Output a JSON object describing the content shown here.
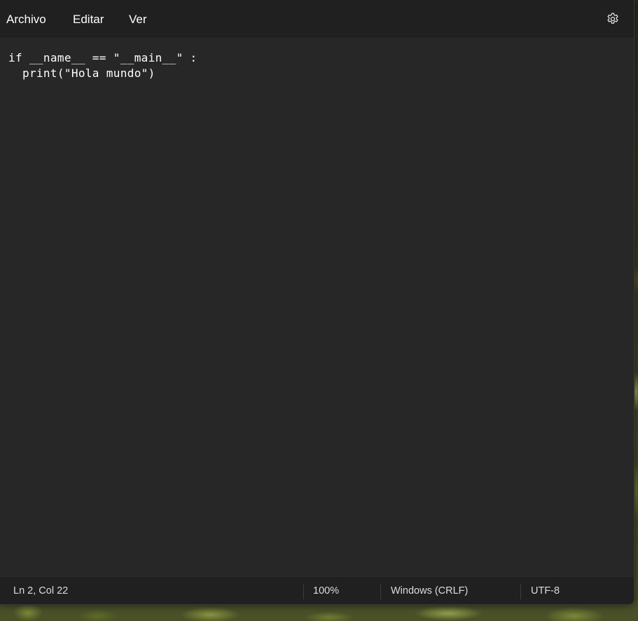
{
  "menubar": {
    "items": [
      {
        "label": "Archivo"
      },
      {
        "label": "Editar"
      },
      {
        "label": "Ver"
      }
    ],
    "settings_icon": "gear-icon"
  },
  "editor": {
    "lines": [
      "if __name__ == \"__main__\" :",
      "  print(\"Hola mundo\")"
    ]
  },
  "statusbar": {
    "position": "Ln 2, Col 22",
    "zoom": "100%",
    "line_ending": "Windows (CRLF)",
    "encoding": "UTF-8"
  },
  "colors": {
    "editor_bg": "#272727",
    "menubar_bg": "#202020",
    "text": "#ffffff"
  }
}
